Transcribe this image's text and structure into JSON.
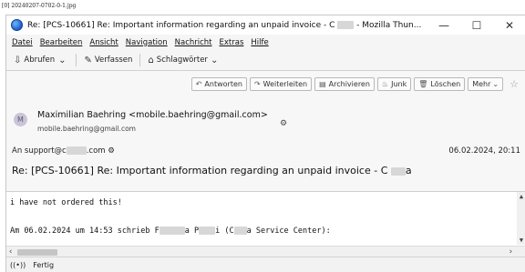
{
  "image_caption": "[0] 20240207-0702-0-1.jpg",
  "window": {
    "title_prefix": "Re: [PCS-10661] Re: Important information regarding an unpaid invoice - C",
    "title_suffix": "- Mozilla Thun...",
    "controls": {
      "minimize": "—",
      "maximize": "☐",
      "close": "✕"
    }
  },
  "menubar": [
    "Datei",
    "Bearbeiten",
    "Ansicht",
    "Navigation",
    "Nachricht",
    "Extras",
    "Hilfe"
  ],
  "toolbar": {
    "get_messages": "Abrufen",
    "compose": "Verfassen",
    "tags": "Schlagwörter"
  },
  "message_actions": {
    "reply": "Antworten",
    "forward": "Weiterleiten",
    "archive": "Archivieren",
    "junk": "Junk",
    "delete": "Löschen",
    "more": "Mehr"
  },
  "header": {
    "avatar_letter": "M",
    "from": "Maximilian Baehring <mobile.baehring@gmail.com>",
    "from_sub": "mobile.baehring@gmail.com",
    "to_prefix": "An",
    "to_address_start": "support@c",
    "to_address_end": ".com",
    "date": "06.02.2024, 20:11",
    "subject_prefix": "Re: [PCS-10661] Re: Important information regarding an unpaid invoice - C",
    "subject_suffix": "a"
  },
  "body": {
    "line1": "i have not ordered this!",
    "line2_start": "Am 06.02.2024 um 14:53 schrieb F",
    "line2_mid1": "a P",
    "line2_mid2": "i (C",
    "line2_end": "a Service Center):"
  },
  "status": {
    "icon": "((•))",
    "text": "Fertig"
  }
}
